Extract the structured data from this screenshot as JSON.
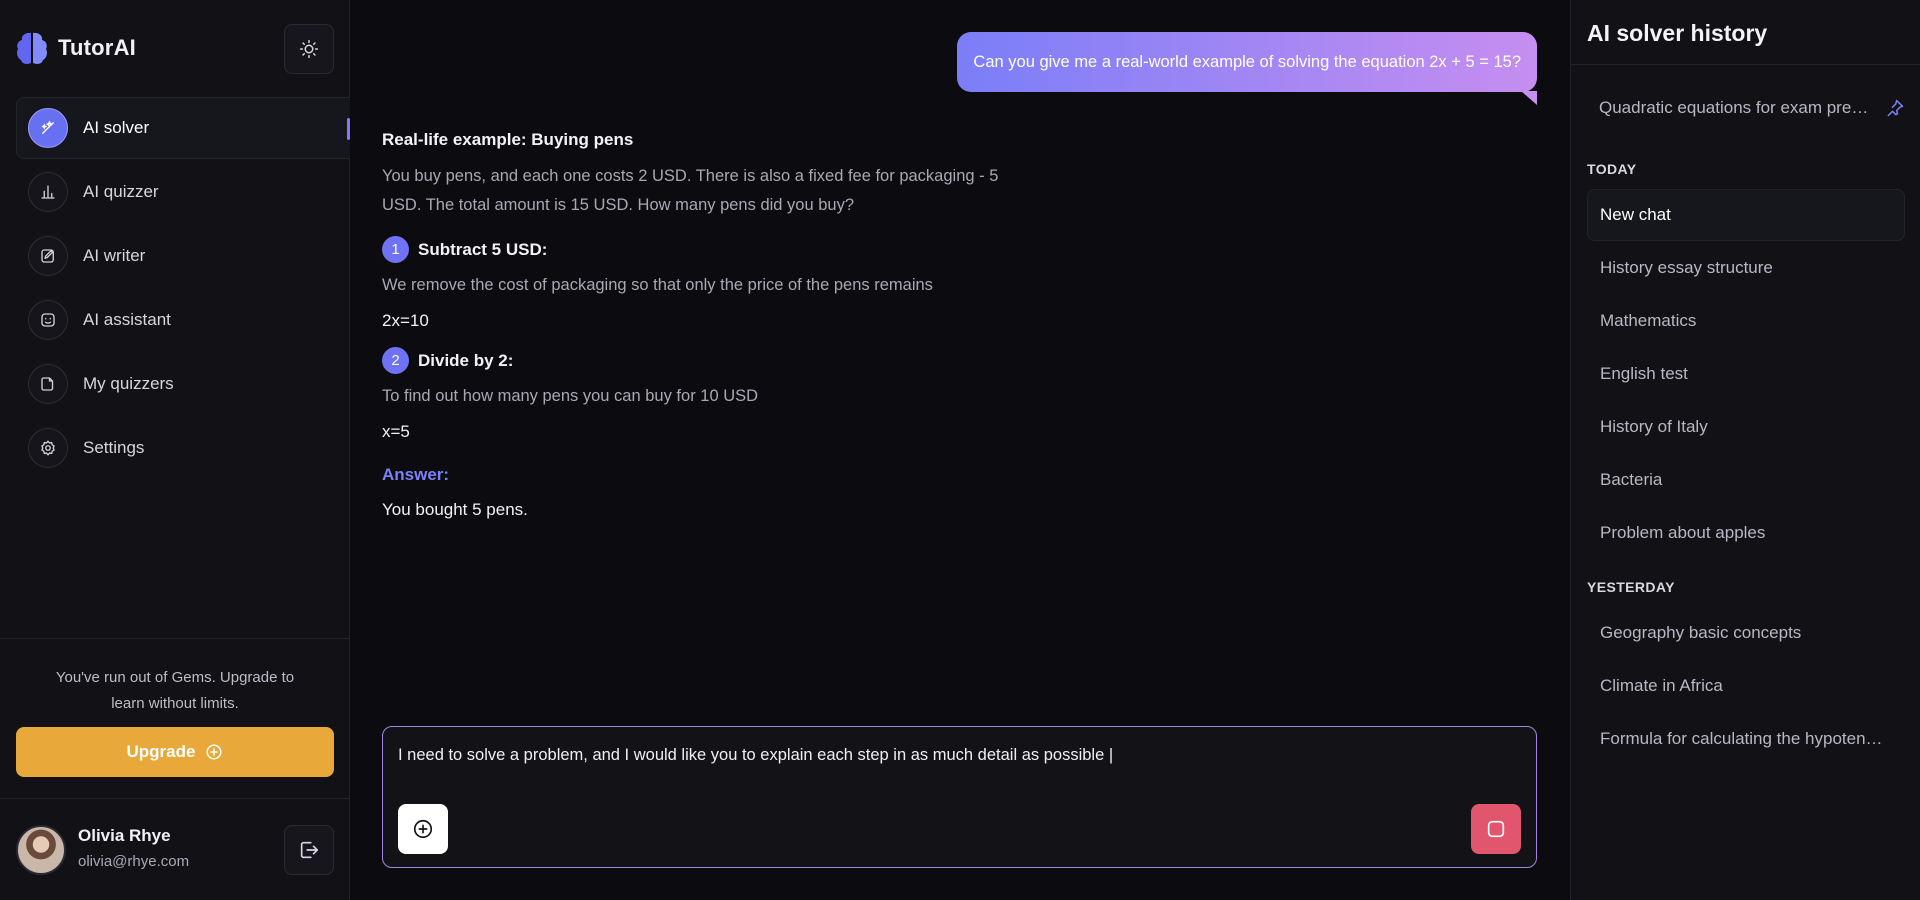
{
  "app": {
    "name": "TutorAI"
  },
  "sidebar": {
    "items": [
      {
        "label": "AI solver",
        "icon": "sparkle-icon",
        "active": true
      },
      {
        "label": "AI quizzer",
        "icon": "bar-chart-icon",
        "active": false
      },
      {
        "label": "AI writer",
        "icon": "edit-icon",
        "active": false
      },
      {
        "label": "AI assistant",
        "icon": "smile-icon",
        "active": false
      },
      {
        "label": "My quizzers",
        "icon": "document-icon",
        "active": false
      },
      {
        "label": "Settings",
        "icon": "gear-icon",
        "active": false
      }
    ],
    "gems_text": "You've run out of Gems. Upgrade to learn without limits.",
    "upgrade_label": "Upgrade",
    "user": {
      "name": "Olivia Rhye",
      "email": "olivia@rhye.com"
    }
  },
  "chat": {
    "user_message": "Can you give me a real-world example of solving the equation 2x + 5 = 15?",
    "answer": {
      "title": "Real-life example: Buying pens",
      "intro": "You buy pens, and each one costs 2 USD. There is also a fixed fee for packaging - 5 USD. The total amount is 15 USD. How many pens did you buy?",
      "steps": [
        {
          "number": "1",
          "title": "Subtract 5 USD:",
          "description": "We remove the cost of packaging so that only the price of the pens remains",
          "equation": "2x=10"
        },
        {
          "number": "2",
          "title": "Divide by 2:",
          "description": "To find out how many pens you can buy for 10 USD",
          "equation": "x=5"
        }
      ],
      "answer_label": "Answer:",
      "answer_text": "You bought 5 pens."
    },
    "composer_text": "I need to solve a problem, and I would like you to explain each step in as much detail as possible |"
  },
  "history": {
    "title": "AI solver history",
    "pinned": "Quadratic equations for exam preparation",
    "sections": [
      {
        "label": "TODAY",
        "items": [
          "New chat",
          "History essay structure",
          "Mathematics",
          "English test",
          "History of Italy",
          "Bacteria",
          "Problem about apples"
        ]
      },
      {
        "label": "YESTERDAY",
        "items": [
          "Geography basic concepts",
          "Climate in Africa",
          "Formula for calculating the hypotenuse"
        ]
      }
    ],
    "active_item": "New chat"
  },
  "colors": {
    "accent": "#6f72f2",
    "upgrade": "#e8a93a",
    "stop": "#e1566c",
    "bubble_start": "#7b7ef8",
    "bubble_end": "#c68ef0"
  }
}
